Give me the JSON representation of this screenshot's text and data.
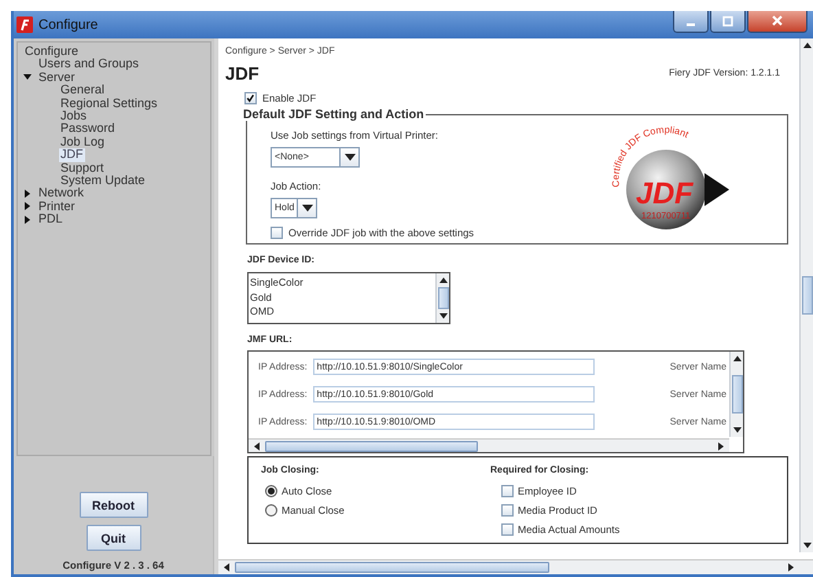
{
  "window": {
    "title": "Configure"
  },
  "tree": [
    {
      "label": "Configure",
      "kind": "root",
      "selected": false,
      "children": [
        {
          "label": "Users and Groups",
          "selected": false
        },
        {
          "label": "Server",
          "kind": "folder",
          "expanded": true,
          "selected": false,
          "children": [
            {
              "label": "General",
              "selected": false
            },
            {
              "label": "Regional Settings",
              "selected": false
            },
            {
              "label": "Jobs",
              "selected": false
            },
            {
              "label": "Password",
              "selected": false
            },
            {
              "label": "Job Log",
              "selected": false
            },
            {
              "label": "JDF",
              "selected": true
            },
            {
              "label": "Support",
              "selected": false
            },
            {
              "label": "System Update",
              "selected": false
            }
          ]
        },
        {
          "label": "Network",
          "kind": "folder",
          "expanded": false,
          "selected": false
        },
        {
          "label": "Printer",
          "kind": "folder",
          "expanded": false,
          "selected": false
        },
        {
          "label": "PDL",
          "kind": "folder",
          "expanded": false,
          "selected": false
        }
      ]
    }
  ],
  "sidebar_buttons": [
    "Reboot",
    "Quit"
  ],
  "app_version": "Configure V 2 . 3 . 64",
  "breadcrumb": "Configure > Server > JDF",
  "heading": "JDF",
  "jdf_version": "Fiery JDF Version:  1.2.1.1",
  "enable": {
    "label": "Enable JDF",
    "checked": true
  },
  "default_group": {
    "title": "Default JDF Setting and Action",
    "virtual_printer_label": "Use Job settings from Virtual Printer:",
    "virtual_printer_value": "<None>",
    "job_action_label": "Job Action:",
    "job_action_value": "Hold",
    "override": {
      "label": "Override JDF job with the above settings",
      "checked": false
    },
    "logo": {
      "arc_text": "Certified JDF Compliant",
      "mark": "JDF",
      "number": "1210700711"
    }
  },
  "device_id": {
    "label": "JDF Device ID:",
    "items": [
      "SingleColor",
      "Gold",
      "OMD"
    ]
  },
  "jmf": {
    "label": "JMF URL:",
    "rows": [
      {
        "label": "IP Address:",
        "value": "http://10.10.51.9:8010/SingleColor",
        "server_label": "Server Name"
      },
      {
        "label": "IP Address:",
        "value": "http://10.10.51.9:8010/Gold",
        "server_label": "Server Name"
      },
      {
        "label": "IP Address:",
        "value": "http://10.10.51.9:8010/OMD",
        "server_label": "Server Name"
      }
    ]
  },
  "job_closing": {
    "label": "Job Closing:",
    "options": [
      {
        "label": "Auto Close",
        "selected": true
      },
      {
        "label": "Manual Close",
        "selected": false
      }
    ]
  },
  "required": {
    "label": "Required for Closing:",
    "options": [
      {
        "label": "Employee ID",
        "checked": false
      },
      {
        "label": "Media Product ID",
        "checked": false
      },
      {
        "label": "Media Actual Amounts",
        "checked": false
      }
    ]
  }
}
